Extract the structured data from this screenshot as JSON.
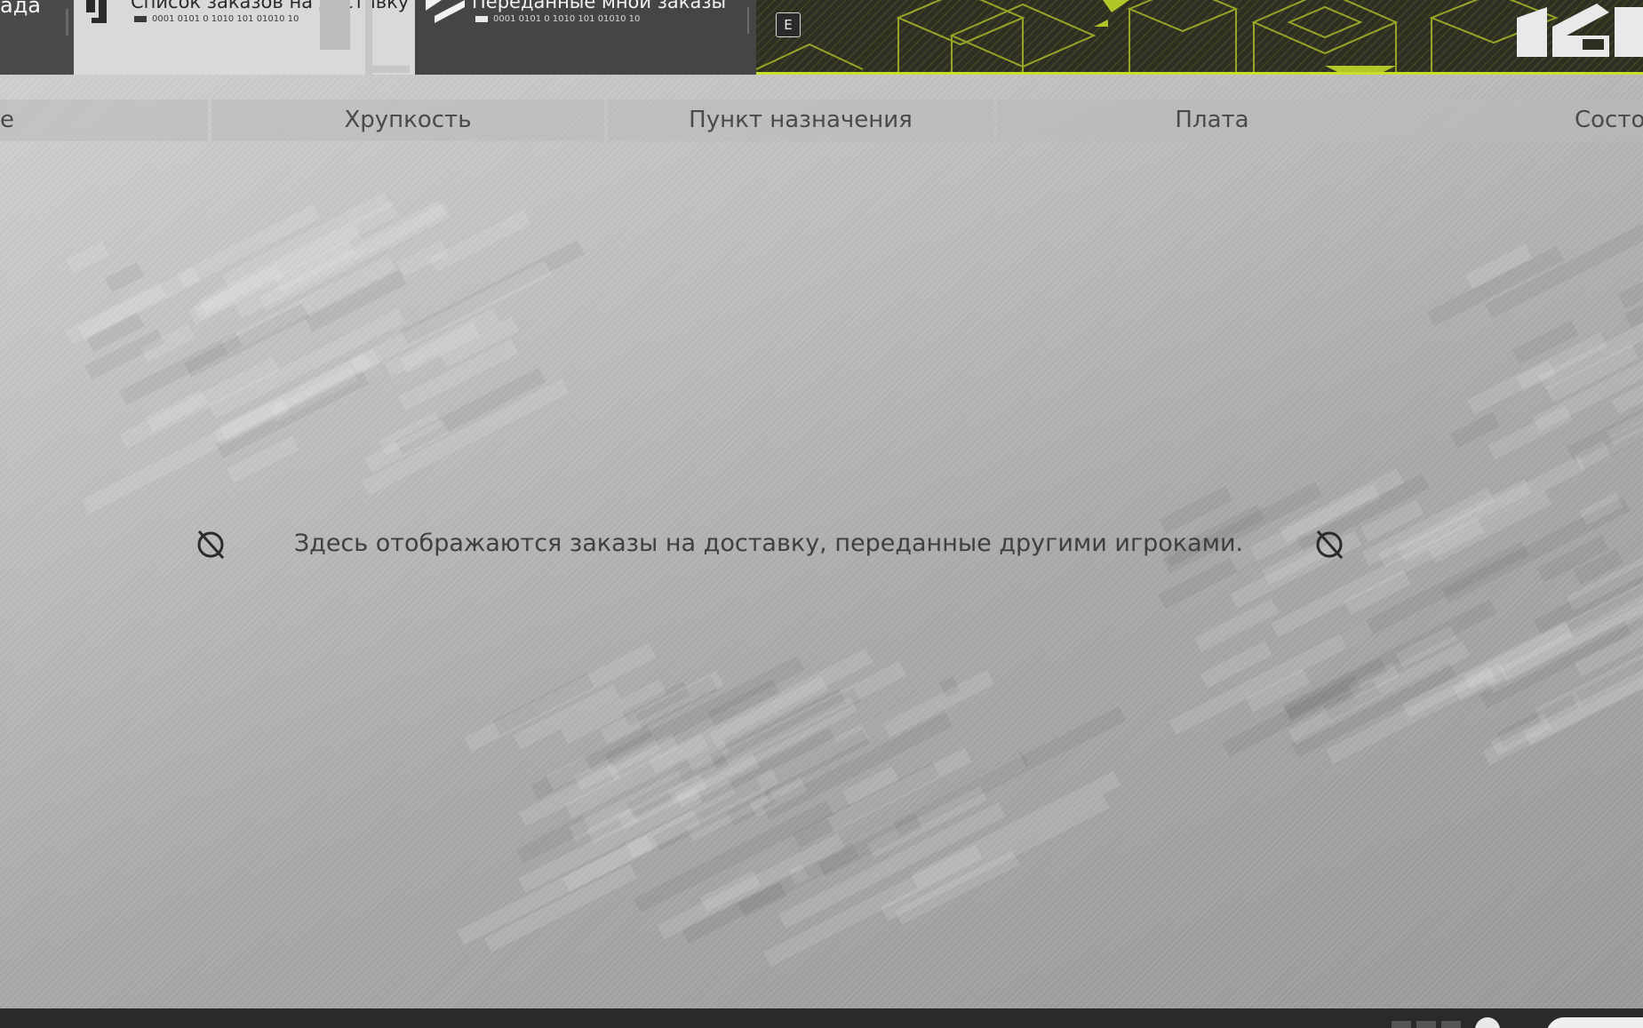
{
  "tabs": {
    "prev_label": "ада",
    "active": {
      "label": "Список заказов на доставку",
      "code": "0001  0101 0 1010 101 01010 10"
    },
    "other": {
      "label": "Переданные мной заказы",
      "code": "0001  0101 0 1010 101 01010 10"
    },
    "key_hint": "E"
  },
  "columns": [
    "е",
    "Хрупкость",
    "Пункт назначения",
    "Плата",
    "Состо"
  ],
  "empty_state": {
    "message": "Здесь отображаются заказы на доставку, переданные другими игроками."
  },
  "colors": {
    "accent": "#c9e02a",
    "tab_dark": "#454545",
    "tab_active": "#d9d9d9",
    "banner_bg": "#2e2f22"
  }
}
